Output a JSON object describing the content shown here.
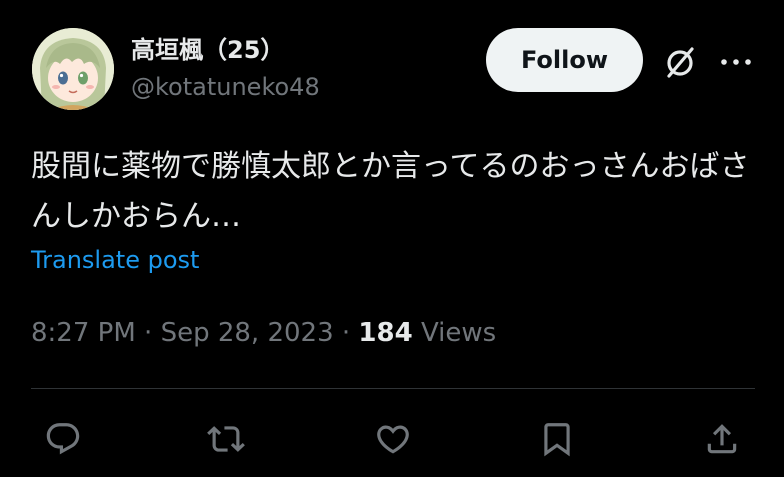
{
  "user": {
    "display_name": "高垣楓（25）",
    "handle": "@kotatuneko48"
  },
  "header": {
    "follow_label": "Follow",
    "grok_icon": "grok-icon",
    "more_icon": "more-horizontal-icon"
  },
  "post": {
    "text": "股間に薬物で勝慎太郎とか言ってるのおっさんおばさんしかおらん…",
    "translate_label": "Translate post",
    "time": "8:27 PM",
    "separator1": " · ",
    "date": "Sep 28, 2023",
    "separator2": " · ",
    "views_count": "184",
    "views_label": " Views"
  },
  "actions": {
    "icons": [
      "reply-icon",
      "retweet-icon",
      "like-icon",
      "bookmark-icon",
      "share-icon"
    ]
  },
  "colors": {
    "background": "#000000",
    "text": "#e7e9ea",
    "secondary": "#71767b",
    "link": "#1d9bf0",
    "divider": "#2f3336",
    "follow_bg": "#eff3f4"
  }
}
